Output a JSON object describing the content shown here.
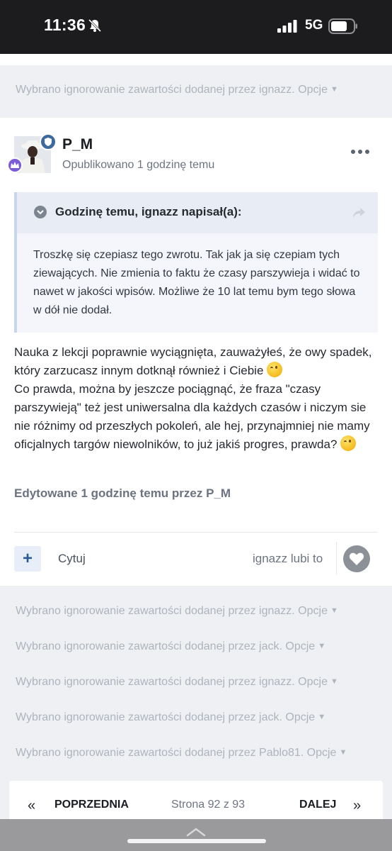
{
  "status_bar": {
    "time": "11:36",
    "network": "5G"
  },
  "ignored_top": {
    "text": "Wybrano ignorowanie zawartości dodanej przez ignazz. Opcje"
  },
  "post": {
    "author": "P_M",
    "published": "Opublikowano 1 godzinę temu",
    "quote": {
      "author_line": "Godzinę temu, ignazz napisał(a):",
      "text": "Troszkę się czepiasz tego zwrotu. Tak jak ja się czepiam tych ziewających. Nie zmienia to faktu że czasy parszywieja i widać to nawet w jakości wpisów. Możliwe że 10 lat temu bym tego słowa w dół nie dodał."
    },
    "body_part1": "Nauka z lekcji poprawnie wyciągnięta, zauważyłeś, że owy spadek, który zarzucasz innym dotknął również i Ciebie",
    "body_part2": "Co prawda, można by jeszcze pociągnąć, że fraza \"czasy parszywieją\" też jest uniwersalna dla każdych czasów i niczym sie nie różnimy od przeszłych pokoleń, ale hej, przynajmniej nie mamy oficjalnych targów niewolników, to już jakiś progres, prawda?",
    "edited": "Edytowane 1 godzinę temu przez P_M",
    "actions": {
      "plus": "+",
      "quote": "Cytuj",
      "likes": "ignazz lubi to"
    }
  },
  "ignored_rows": [
    {
      "text": "Wybrano ignorowanie zawartości dodanej przez ignazz. Opcje"
    },
    {
      "text": "Wybrano ignorowanie zawartości dodanej przez jack. Opcje"
    },
    {
      "text": "Wybrano ignorowanie zawartości dodanej przez ignazz. Opcje"
    },
    {
      "text": "Wybrano ignorowanie zawartości dodanej przez jack. Opcje"
    },
    {
      "text": "Wybrano ignorowanie zawartości dodanej przez Pablo81. Opcje"
    }
  ],
  "pagination": {
    "prev_arrow": "«",
    "prev": "POPRZEDNIA",
    "info": "Strona 92 z 93",
    "next": "DALEJ",
    "next_arrow": "»"
  },
  "colors": {
    "accent": "#2b5b92",
    "muted": "#aeb4bd",
    "background": "#eef0f3"
  }
}
